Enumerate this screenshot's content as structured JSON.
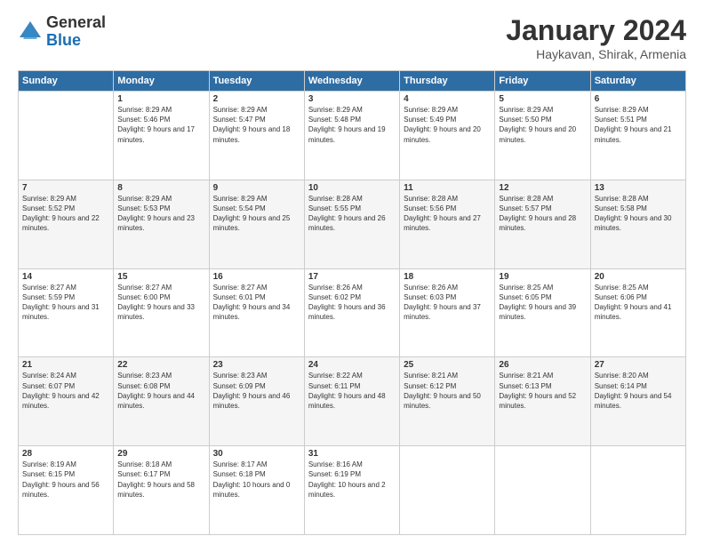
{
  "logo": {
    "general": "General",
    "blue": "Blue"
  },
  "title": "January 2024",
  "location": "Haykavan, Shirak, Armenia",
  "days_header": [
    "Sunday",
    "Monday",
    "Tuesday",
    "Wednesday",
    "Thursday",
    "Friday",
    "Saturday"
  ],
  "weeks": [
    [
      {
        "day": "",
        "sunrise": "",
        "sunset": "",
        "daylight": ""
      },
      {
        "day": "1",
        "sunrise": "Sunrise: 8:29 AM",
        "sunset": "Sunset: 5:46 PM",
        "daylight": "Daylight: 9 hours and 17 minutes."
      },
      {
        "day": "2",
        "sunrise": "Sunrise: 8:29 AM",
        "sunset": "Sunset: 5:47 PM",
        "daylight": "Daylight: 9 hours and 18 minutes."
      },
      {
        "day": "3",
        "sunrise": "Sunrise: 8:29 AM",
        "sunset": "Sunset: 5:48 PM",
        "daylight": "Daylight: 9 hours and 19 minutes."
      },
      {
        "day": "4",
        "sunrise": "Sunrise: 8:29 AM",
        "sunset": "Sunset: 5:49 PM",
        "daylight": "Daylight: 9 hours and 20 minutes."
      },
      {
        "day": "5",
        "sunrise": "Sunrise: 8:29 AM",
        "sunset": "Sunset: 5:50 PM",
        "daylight": "Daylight: 9 hours and 20 minutes."
      },
      {
        "day": "6",
        "sunrise": "Sunrise: 8:29 AM",
        "sunset": "Sunset: 5:51 PM",
        "daylight": "Daylight: 9 hours and 21 minutes."
      }
    ],
    [
      {
        "day": "7",
        "sunrise": "Sunrise: 8:29 AM",
        "sunset": "Sunset: 5:52 PM",
        "daylight": "Daylight: 9 hours and 22 minutes."
      },
      {
        "day": "8",
        "sunrise": "Sunrise: 8:29 AM",
        "sunset": "Sunset: 5:53 PM",
        "daylight": "Daylight: 9 hours and 23 minutes."
      },
      {
        "day": "9",
        "sunrise": "Sunrise: 8:29 AM",
        "sunset": "Sunset: 5:54 PM",
        "daylight": "Daylight: 9 hours and 25 minutes."
      },
      {
        "day": "10",
        "sunrise": "Sunrise: 8:28 AM",
        "sunset": "Sunset: 5:55 PM",
        "daylight": "Daylight: 9 hours and 26 minutes."
      },
      {
        "day": "11",
        "sunrise": "Sunrise: 8:28 AM",
        "sunset": "Sunset: 5:56 PM",
        "daylight": "Daylight: 9 hours and 27 minutes."
      },
      {
        "day": "12",
        "sunrise": "Sunrise: 8:28 AM",
        "sunset": "Sunset: 5:57 PM",
        "daylight": "Daylight: 9 hours and 28 minutes."
      },
      {
        "day": "13",
        "sunrise": "Sunrise: 8:28 AM",
        "sunset": "Sunset: 5:58 PM",
        "daylight": "Daylight: 9 hours and 30 minutes."
      }
    ],
    [
      {
        "day": "14",
        "sunrise": "Sunrise: 8:27 AM",
        "sunset": "Sunset: 5:59 PM",
        "daylight": "Daylight: 9 hours and 31 minutes."
      },
      {
        "day": "15",
        "sunrise": "Sunrise: 8:27 AM",
        "sunset": "Sunset: 6:00 PM",
        "daylight": "Daylight: 9 hours and 33 minutes."
      },
      {
        "day": "16",
        "sunrise": "Sunrise: 8:27 AM",
        "sunset": "Sunset: 6:01 PM",
        "daylight": "Daylight: 9 hours and 34 minutes."
      },
      {
        "day": "17",
        "sunrise": "Sunrise: 8:26 AM",
        "sunset": "Sunset: 6:02 PM",
        "daylight": "Daylight: 9 hours and 36 minutes."
      },
      {
        "day": "18",
        "sunrise": "Sunrise: 8:26 AM",
        "sunset": "Sunset: 6:03 PM",
        "daylight": "Daylight: 9 hours and 37 minutes."
      },
      {
        "day": "19",
        "sunrise": "Sunrise: 8:25 AM",
        "sunset": "Sunset: 6:05 PM",
        "daylight": "Daylight: 9 hours and 39 minutes."
      },
      {
        "day": "20",
        "sunrise": "Sunrise: 8:25 AM",
        "sunset": "Sunset: 6:06 PM",
        "daylight": "Daylight: 9 hours and 41 minutes."
      }
    ],
    [
      {
        "day": "21",
        "sunrise": "Sunrise: 8:24 AM",
        "sunset": "Sunset: 6:07 PM",
        "daylight": "Daylight: 9 hours and 42 minutes."
      },
      {
        "day": "22",
        "sunrise": "Sunrise: 8:23 AM",
        "sunset": "Sunset: 6:08 PM",
        "daylight": "Daylight: 9 hours and 44 minutes."
      },
      {
        "day": "23",
        "sunrise": "Sunrise: 8:23 AM",
        "sunset": "Sunset: 6:09 PM",
        "daylight": "Daylight: 9 hours and 46 minutes."
      },
      {
        "day": "24",
        "sunrise": "Sunrise: 8:22 AM",
        "sunset": "Sunset: 6:11 PM",
        "daylight": "Daylight: 9 hours and 48 minutes."
      },
      {
        "day": "25",
        "sunrise": "Sunrise: 8:21 AM",
        "sunset": "Sunset: 6:12 PM",
        "daylight": "Daylight: 9 hours and 50 minutes."
      },
      {
        "day": "26",
        "sunrise": "Sunrise: 8:21 AM",
        "sunset": "Sunset: 6:13 PM",
        "daylight": "Daylight: 9 hours and 52 minutes."
      },
      {
        "day": "27",
        "sunrise": "Sunrise: 8:20 AM",
        "sunset": "Sunset: 6:14 PM",
        "daylight": "Daylight: 9 hours and 54 minutes."
      }
    ],
    [
      {
        "day": "28",
        "sunrise": "Sunrise: 8:19 AM",
        "sunset": "Sunset: 6:15 PM",
        "daylight": "Daylight: 9 hours and 56 minutes."
      },
      {
        "day": "29",
        "sunrise": "Sunrise: 8:18 AM",
        "sunset": "Sunset: 6:17 PM",
        "daylight": "Daylight: 9 hours and 58 minutes."
      },
      {
        "day": "30",
        "sunrise": "Sunrise: 8:17 AM",
        "sunset": "Sunset: 6:18 PM",
        "daylight": "Daylight: 10 hours and 0 minutes."
      },
      {
        "day": "31",
        "sunrise": "Sunrise: 8:16 AM",
        "sunset": "Sunset: 6:19 PM",
        "daylight": "Daylight: 10 hours and 2 minutes."
      },
      {
        "day": "",
        "sunrise": "",
        "sunset": "",
        "daylight": ""
      },
      {
        "day": "",
        "sunrise": "",
        "sunset": "",
        "daylight": ""
      },
      {
        "day": "",
        "sunrise": "",
        "sunset": "",
        "daylight": ""
      }
    ]
  ]
}
